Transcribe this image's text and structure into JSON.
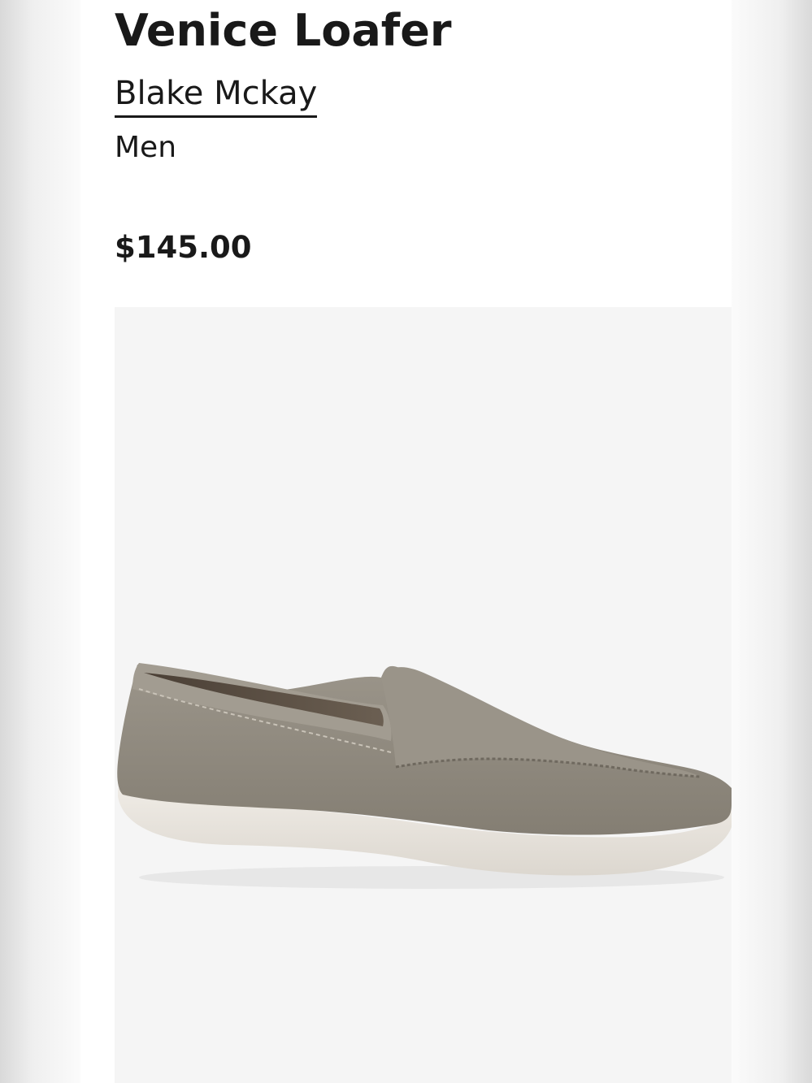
{
  "product": {
    "title": "Venice Loafer",
    "brand": "Blake Mckay",
    "category": "Men",
    "price": "$145.00",
    "image": {
      "description": "product-photo-suede-loafer",
      "colors": {
        "background": "#f5f5f5",
        "suede": "#8f897d",
        "sole": "#e9e5df"
      }
    }
  }
}
